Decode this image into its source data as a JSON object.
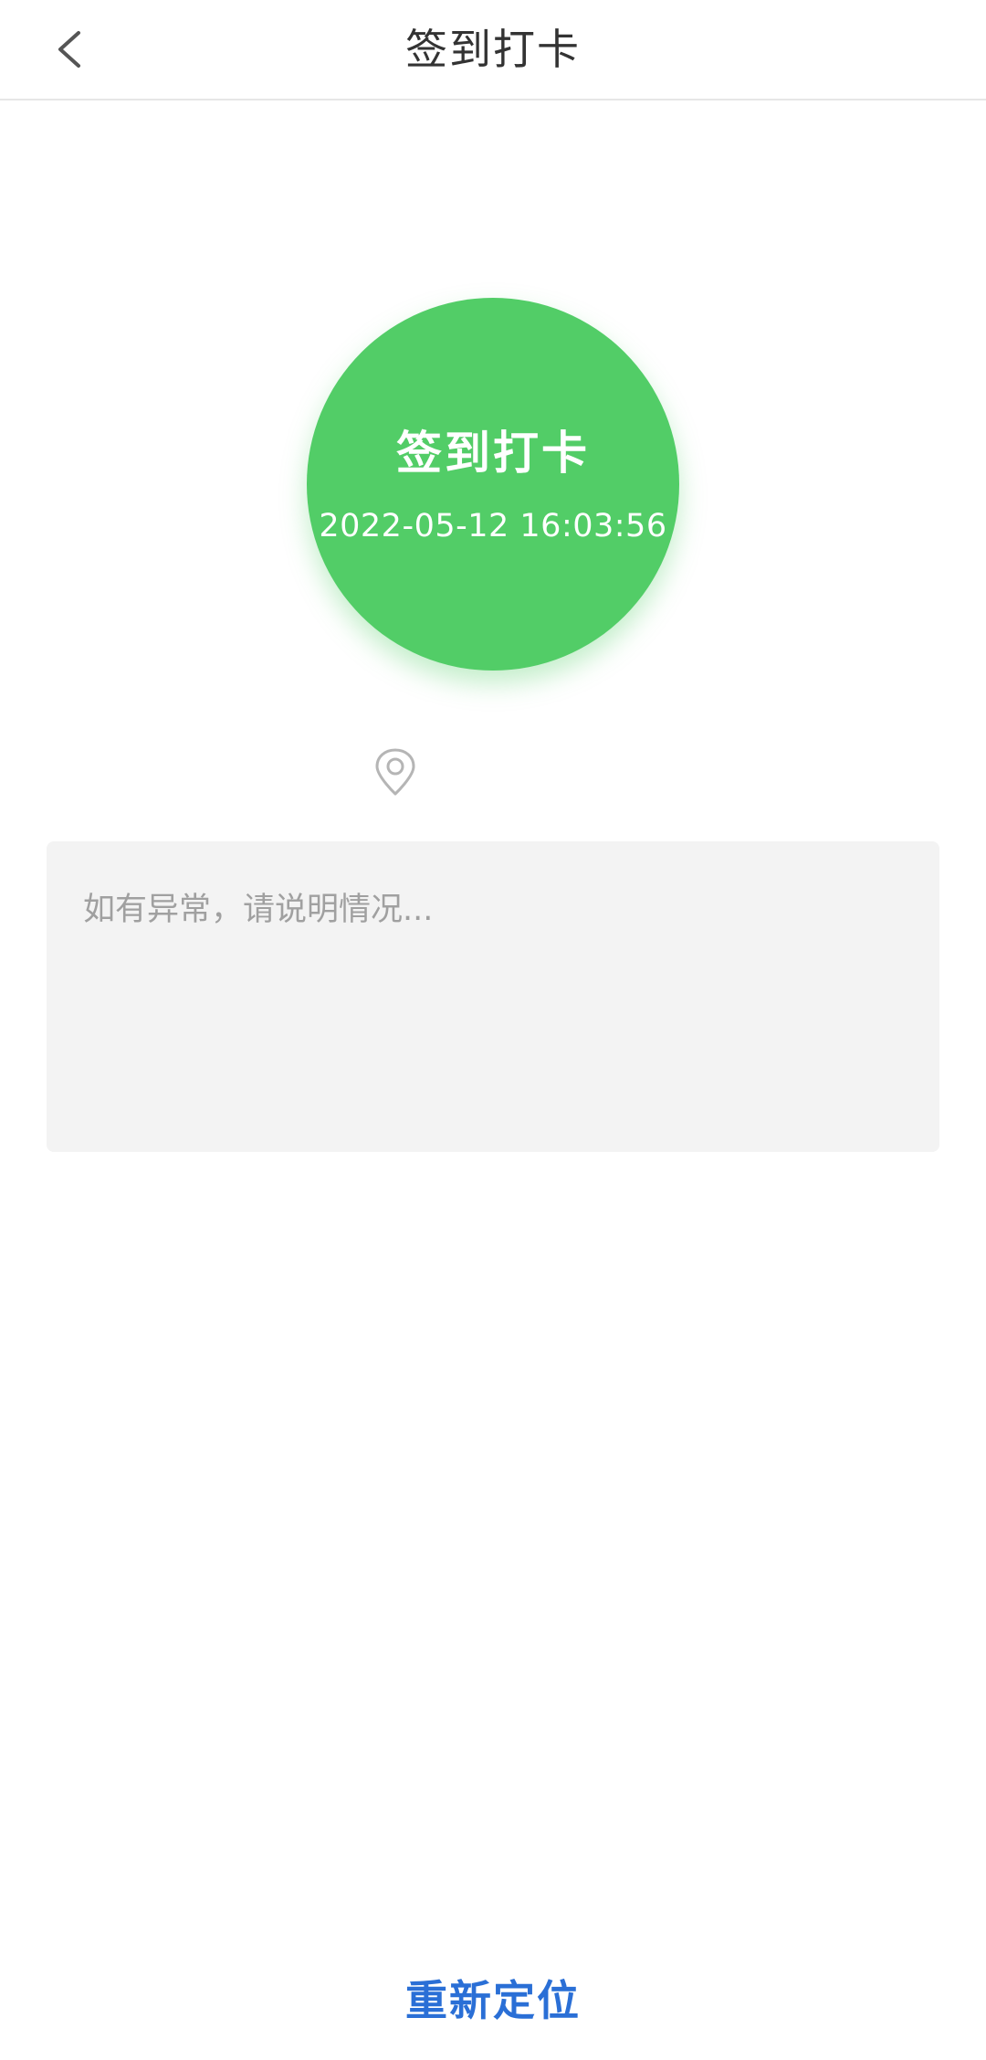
{
  "header": {
    "title": "签到打卡",
    "back_icon": "chevron-left-icon"
  },
  "checkin": {
    "title": "签到打卡",
    "time": "2022-05-12 16:03:56",
    "color": "#52cd67"
  },
  "location": {
    "icon": "location-pin-icon",
    "text": ""
  },
  "remark": {
    "value": "",
    "placeholder": "如有异常，请说明情况..."
  },
  "footer": {
    "relocate_label": "重新定位",
    "color": "#2a6fd6"
  }
}
